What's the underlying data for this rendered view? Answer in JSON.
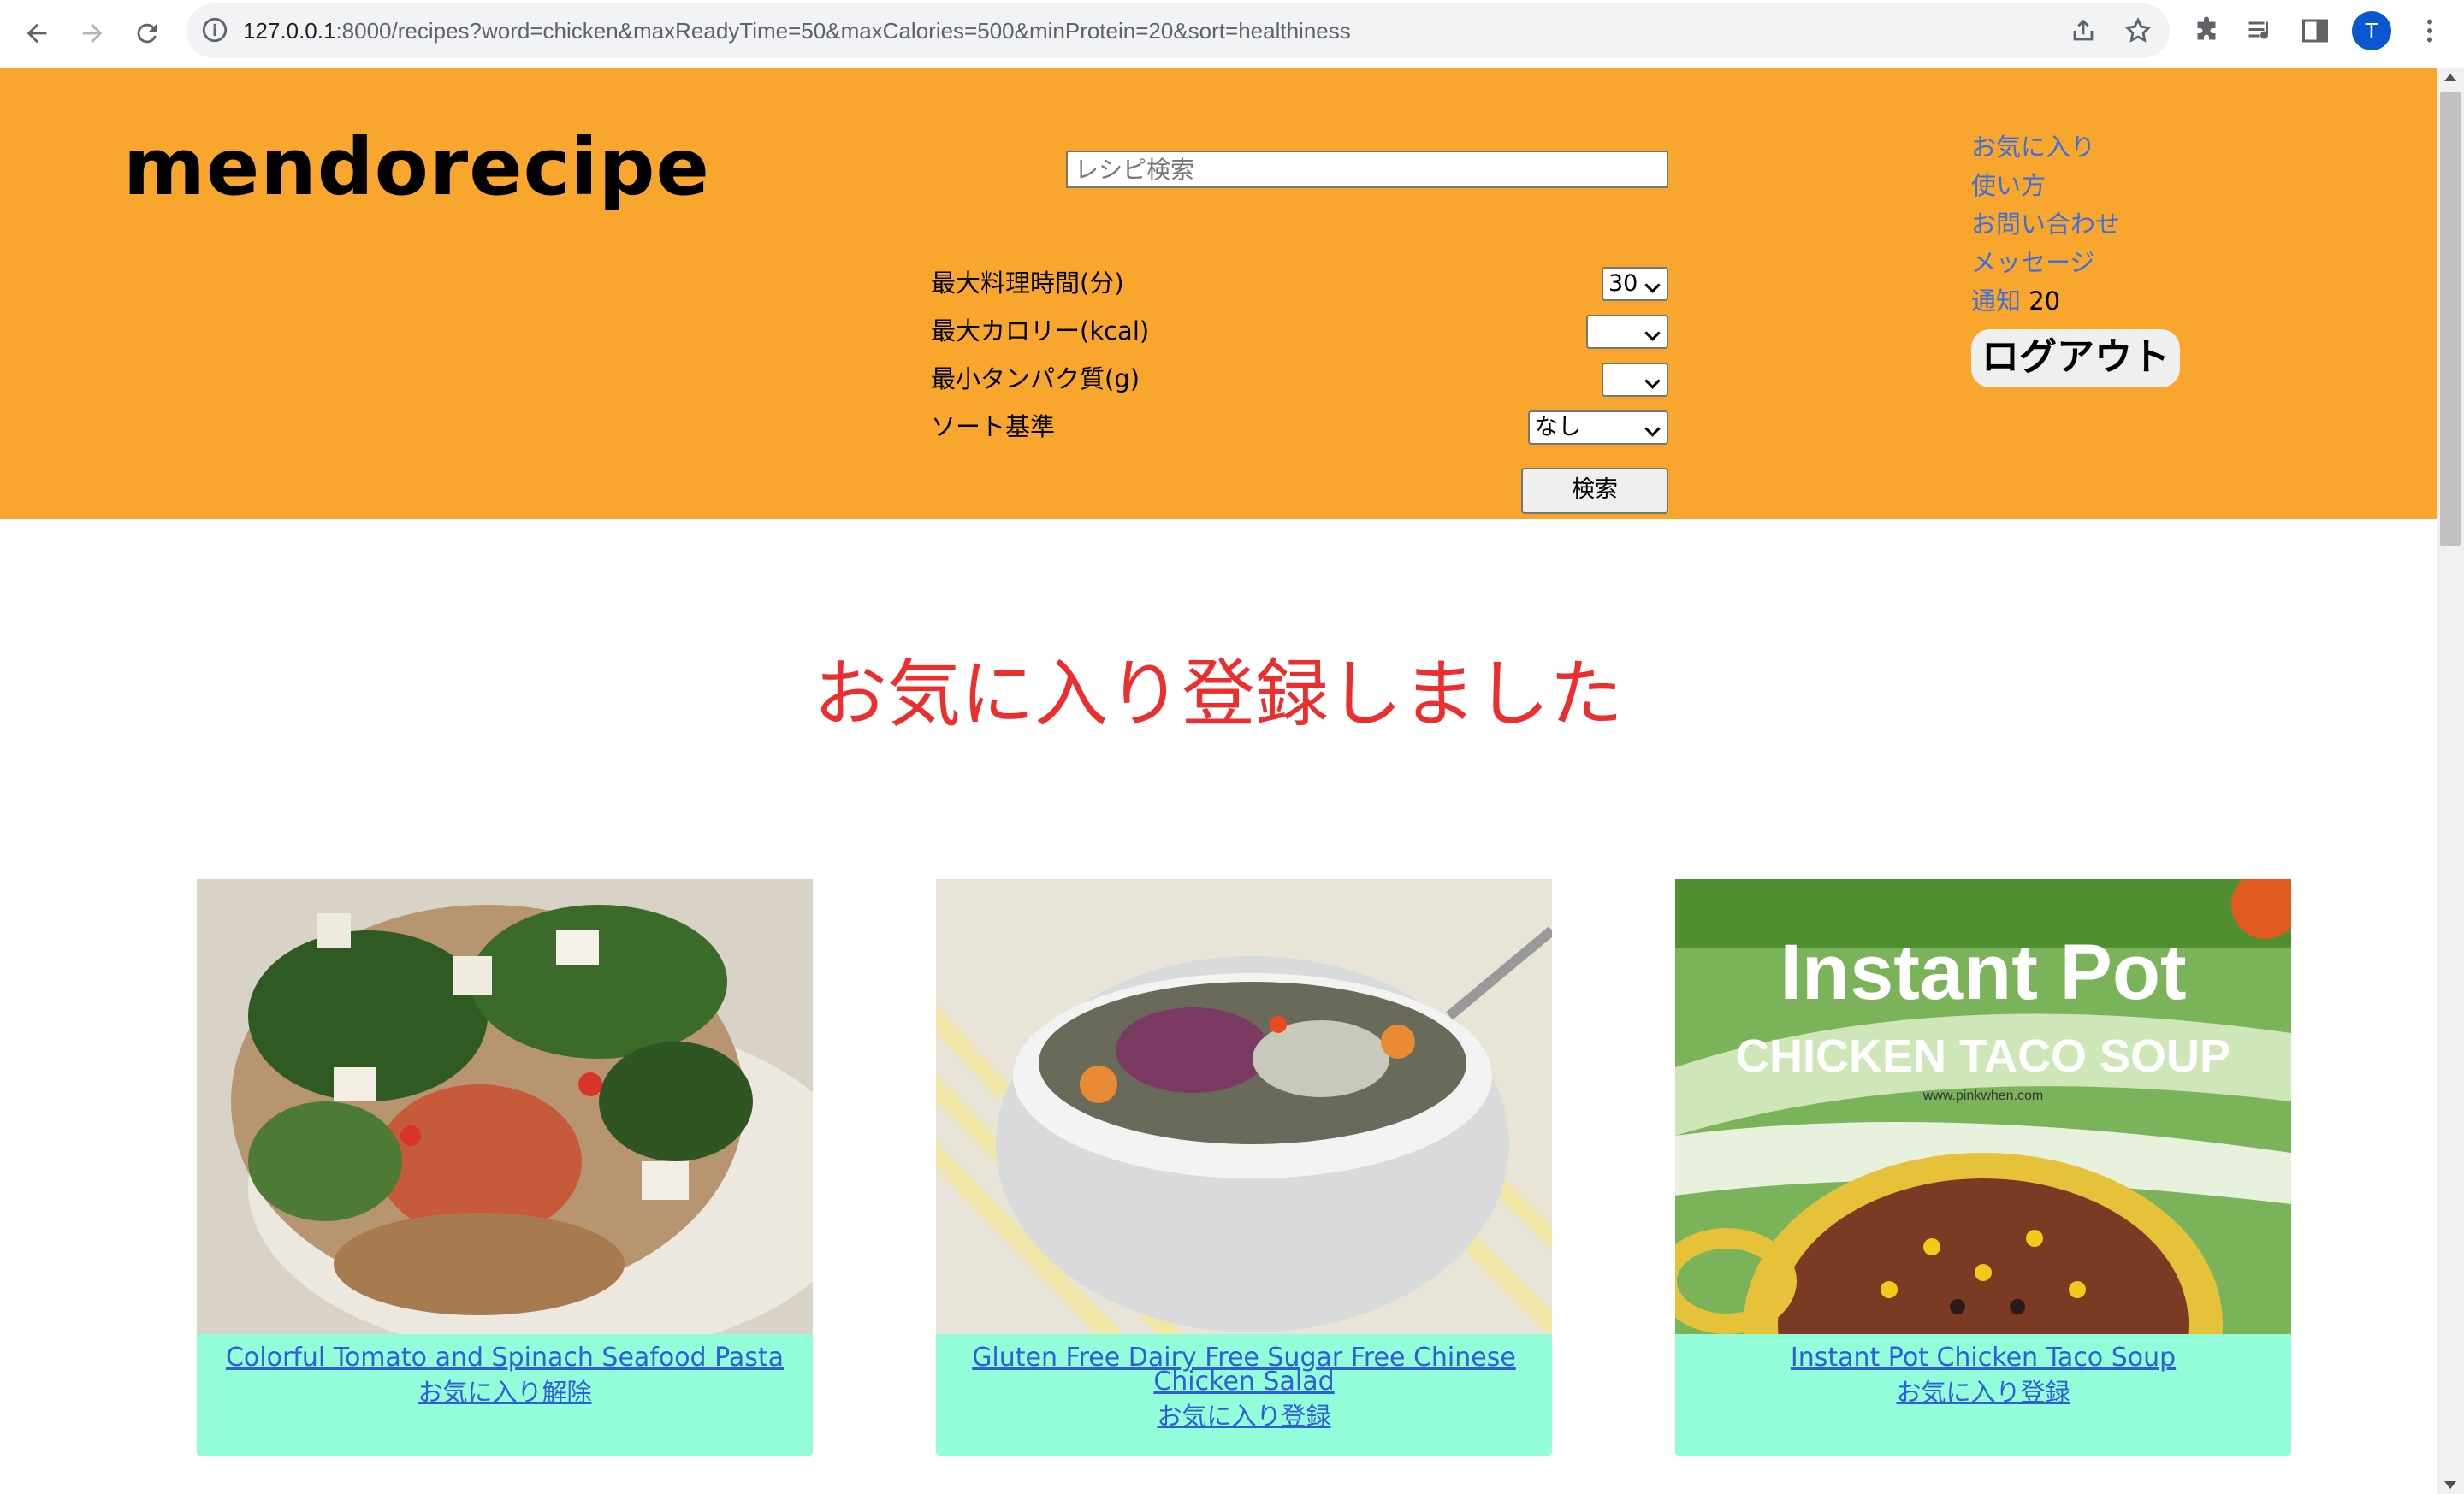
{
  "browser": {
    "url_host": "127.0.0.1",
    "url_rest": ":8000/recipes?word=chicken&maxReadyTime=50&maxCalories=500&minProtein=20&sort=healthiness",
    "profile_initial": "T"
  },
  "site": {
    "logo": "mendorecipe",
    "search": {
      "placeholder": "レシピ検索",
      "value": "",
      "fields": [
        {
          "label": "最大料理時間(分)",
          "selected": "30"
        },
        {
          "label": "最大カロリー(kcal)",
          "selected": ""
        },
        {
          "label": "最小タンパク質(g)",
          "selected": ""
        },
        {
          "label": "ソート基準",
          "selected": "なし"
        }
      ],
      "submit_label": "検索"
    },
    "menu": {
      "favorites": "お気に入り",
      "how_to_use": "使い方",
      "contact": "お問い合わせ",
      "messages": "メッセージ",
      "notifications_label": "通知",
      "notifications_count": "20",
      "logout": "ログアウト"
    },
    "header_color": "#f9a62f"
  },
  "flash_message": "お気に入り登録しました",
  "recipes": [
    {
      "title": "Colorful Tomato and Spinach Seafood Pasta",
      "favorite_action": "お気に入り解除"
    },
    {
      "title": "Gluten Free Dairy Free Sugar Free Chinese Chicken Salad",
      "favorite_action": "お気に入り登録"
    },
    {
      "title": "Instant Pot Chicken Taco Soup",
      "favorite_action": "お気に入り登録",
      "image_text_1": "Instant Pot",
      "image_text_2": "CHICKEN TACO SOUP",
      "image_text_3": "www.pinkwhen.com"
    }
  ],
  "colors": {
    "card_background": "#92fdd8",
    "link": "#2e5fd8",
    "flash": "#ec2e2e"
  }
}
